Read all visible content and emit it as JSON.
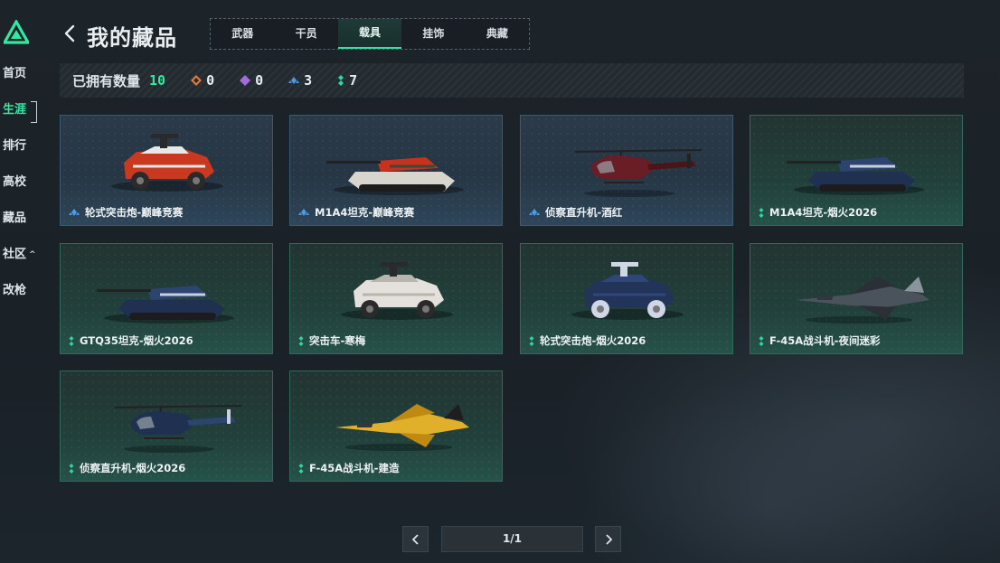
{
  "nav": {
    "items": [
      {
        "label": "首页"
      },
      {
        "label": "生涯",
        "active": true
      },
      {
        "label": "排行"
      },
      {
        "label": "高校"
      },
      {
        "label": "藏品"
      },
      {
        "label": "社区",
        "caret": "^"
      },
      {
        "label": "改枪"
      }
    ]
  },
  "header": {
    "title": "我的藏品",
    "tabs": [
      {
        "label": "武器"
      },
      {
        "label": "干员"
      },
      {
        "label": "载具",
        "active": true
      },
      {
        "label": "挂饰"
      },
      {
        "label": "典藏"
      }
    ]
  },
  "stats": {
    "label": "已拥有数量",
    "total": "10",
    "counts": [
      {
        "icon": "orange-rarity-icon",
        "color": "#e07a3c",
        "value": "0"
      },
      {
        "icon": "purple-rarity-icon",
        "color": "#a46be0",
        "value": "0"
      },
      {
        "icon": "blue-rarity-icon",
        "color": "#4d9be6",
        "value": "3"
      },
      {
        "icon": "green-rarity-icon",
        "color": "#2fd7a0",
        "value": "7"
      }
    ]
  },
  "items": [
    {
      "name": "轮式突击炮-巅峰竞赛",
      "rarity": "blue",
      "kind": "armored-car",
      "colors": [
        "#c8391f",
        "#e8e8e8",
        "#2a2a2a"
      ]
    },
    {
      "name": "M1A4坦克-巅峰竞赛",
      "rarity": "blue",
      "kind": "tank",
      "colors": [
        "#d8d5cf",
        "#c8321c",
        "#3a4a3a"
      ]
    },
    {
      "name": "侦察直升机-酒红",
      "rarity": "blue",
      "kind": "helicopter",
      "colors": [
        "#6a1d24",
        "#4a1418",
        "#222"
      ]
    },
    {
      "name": "M1A4坦克-烟火2026",
      "rarity": "green",
      "kind": "tank",
      "colors": [
        "#1f3050",
        "#2c4470",
        "#c8d0e0"
      ]
    },
    {
      "name": "GTQ35坦克-烟火2026",
      "rarity": "green",
      "kind": "tank",
      "colors": [
        "#1f3050",
        "#2c4470",
        "#c8d0e0"
      ]
    },
    {
      "name": "突击车-寒梅",
      "rarity": "green",
      "kind": "armored-car",
      "colors": [
        "#e4e1dc",
        "#b8b4ae",
        "#2a2a2a"
      ]
    },
    {
      "name": "轮式突击炮-烟火2026",
      "rarity": "green",
      "kind": "armored-car",
      "colors": [
        "#223458",
        "#30467a",
        "#cfd6e6"
      ]
    },
    {
      "name": "F-45A战斗机-夜间迷彩",
      "rarity": "green",
      "kind": "jet",
      "colors": [
        "#4a535c",
        "#2a3036",
        "#8a949c"
      ]
    },
    {
      "name": "侦察直升机-烟火2026",
      "rarity": "green",
      "kind": "helicopter",
      "colors": [
        "#1f3050",
        "#2c4470",
        "#c8d0e0"
      ]
    },
    {
      "name": "F-45A战斗机-建造",
      "rarity": "green",
      "kind": "jet",
      "colors": [
        "#e0b02a",
        "#c08a12",
        "#1e1e1e"
      ]
    }
  ],
  "pagination": {
    "page": "1/1"
  },
  "colors": {
    "accent": "#35e7a0"
  }
}
